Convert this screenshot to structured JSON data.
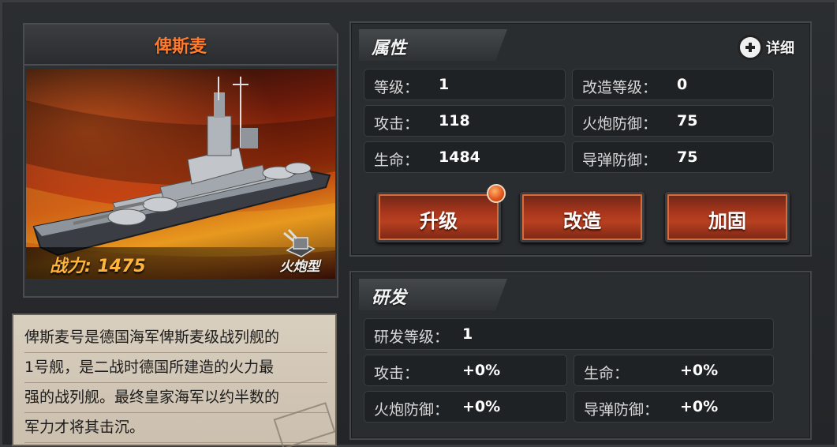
{
  "ship": {
    "name": "俾斯麦",
    "power_label": "战力: 1475",
    "type_label": "火炮型",
    "description_lines": [
      "俾斯麦号是德国海军俾斯麦级战列舰的",
      "1号舰，是二战时德国所建造的火力最",
      "强的战列舰。最终皇家海军以约半数的",
      "军力才将其击沉。"
    ]
  },
  "attributes": {
    "tab_label": "属性",
    "detail_label": "详细",
    "stats": {
      "level": {
        "label": "等级：",
        "value": "1"
      },
      "refit_level": {
        "label": "改造等级：",
        "value": "0"
      },
      "attack": {
        "label": "攻击：",
        "value": "118"
      },
      "gun_defense": {
        "label": "火炮防御：",
        "value": "75"
      },
      "hp": {
        "label": "生命：",
        "value": "1484"
      },
      "missile_defense": {
        "label": "导弹防御：",
        "value": "75"
      }
    },
    "buttons": {
      "upgrade": "升级",
      "refit": "改造",
      "reinforce": "加固"
    }
  },
  "research": {
    "tab_label": "研发",
    "level": {
      "label": "研发等级：",
      "value": "1"
    },
    "bonuses": {
      "attack": {
        "label": "攻击：",
        "value": "+0%"
      },
      "hp": {
        "label": "生命：",
        "value": "+0%"
      },
      "gun_defense": {
        "label": "火炮防御：",
        "value": "+0%"
      },
      "missile_defense": {
        "label": "导弹防御：",
        "value": "+0%"
      }
    }
  },
  "colors": {
    "name_orange": "#ff7a2a",
    "power_gold": "#ffb43c",
    "button_red": "#b84020"
  },
  "icons": {
    "detail": "magnifier-plus-icon",
    "type": "naval-gun-icon"
  }
}
